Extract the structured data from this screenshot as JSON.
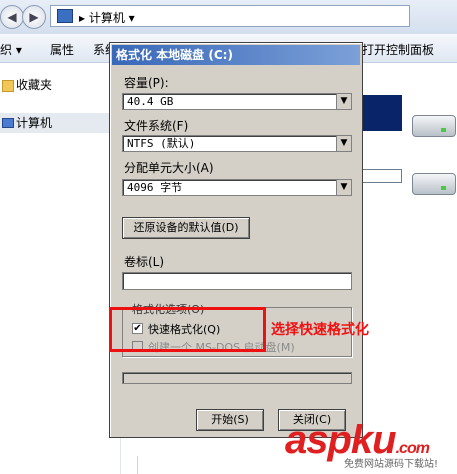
{
  "explorer": {
    "back_glyph": "◀",
    "forward_glyph": "▶",
    "address_path": "▸ 计算机 ▾",
    "toolbar": {
      "organize": "织 ▾",
      "properties": "属性",
      "system": "系统",
      "control_panel": "打开控制面板"
    },
    "sidebar": [
      {
        "label": "收藏夹",
        "icon": "folder-icon"
      },
      {
        "label": "计算机",
        "icon": "computer-icon"
      }
    ]
  },
  "dialog": {
    "title": "格式化 本地磁盘 (C:)",
    "capacity_label": "容量(P):",
    "capacity_value": "40.4 GB",
    "filesystem_label": "文件系统(F)",
    "filesystem_value": "NTFS (默认)",
    "alloc_label": "分配单元大小(A)",
    "alloc_value": "4096 字节",
    "restore_button": "还原设备的默认值(D)",
    "volume_label": "卷标(L)",
    "volume_value": "",
    "options_title": "格式化选项(O)",
    "quick_format_label": "快速格式化(Q)",
    "quick_format_checked": true,
    "msdos_label": "创建一个 MS-DOS 启动盘(M)",
    "msdos_checked": false,
    "start_button": "开始(S)",
    "close_button": "关闭(C)",
    "dropdown_glyph": "▼",
    "check_glyph": "✔"
  },
  "annotation_text": "选择快速格式化",
  "watermark": {
    "brand": "aspku",
    "tld": ".com",
    "tagline": "免费网站源码下载站!"
  },
  "colors": {
    "highlight": "#ee1111",
    "titlebar": "#3868b8",
    "dialog_face": "#d4d0c8"
  }
}
